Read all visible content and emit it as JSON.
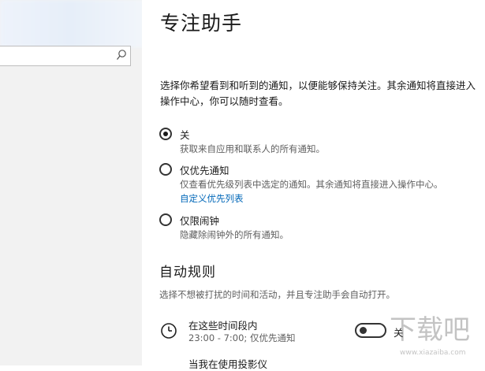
{
  "header": {
    "title": "专注助手"
  },
  "description": "选择你希望看到和听到的通知，以便能够保持关注。其余通知将直接进入操作中心，你可以随时查看。",
  "options": [
    {
      "label": "关",
      "desc": "获取来自应用和联系人的所有通知。",
      "checked": true
    },
    {
      "label": "仅优先通知",
      "desc": "仅查看优先级列表中选定的通知。其余通知将直接进入操作中心。",
      "link": "自定义优先列表",
      "checked": false
    },
    {
      "label": "仅限闹钟",
      "desc": "隐藏除闹钟外的所有通知。",
      "checked": false
    }
  ],
  "auto_rules": {
    "title": "自动规则",
    "desc": "选择不想被打扰的时间和活动，并且专注助手会自动打开。",
    "items": [
      {
        "title": "在这些时间段内",
        "sub": "23:00 - 7:00; 仅优先通知",
        "toggle_label": "关",
        "toggle_on": false
      },
      {
        "title": "当我在使用投影仪"
      }
    ]
  },
  "watermark": {
    "text": "下载吧",
    "url": "www.xiazaiba.com"
  },
  "colors": {
    "link": "#0067b8",
    "sidebar_bg": "#f2f2f2",
    "text": "#1a1a1a",
    "subtext": "#5f5f5f"
  },
  "icons": {
    "search": "search-icon",
    "clock": "clock-icon"
  }
}
